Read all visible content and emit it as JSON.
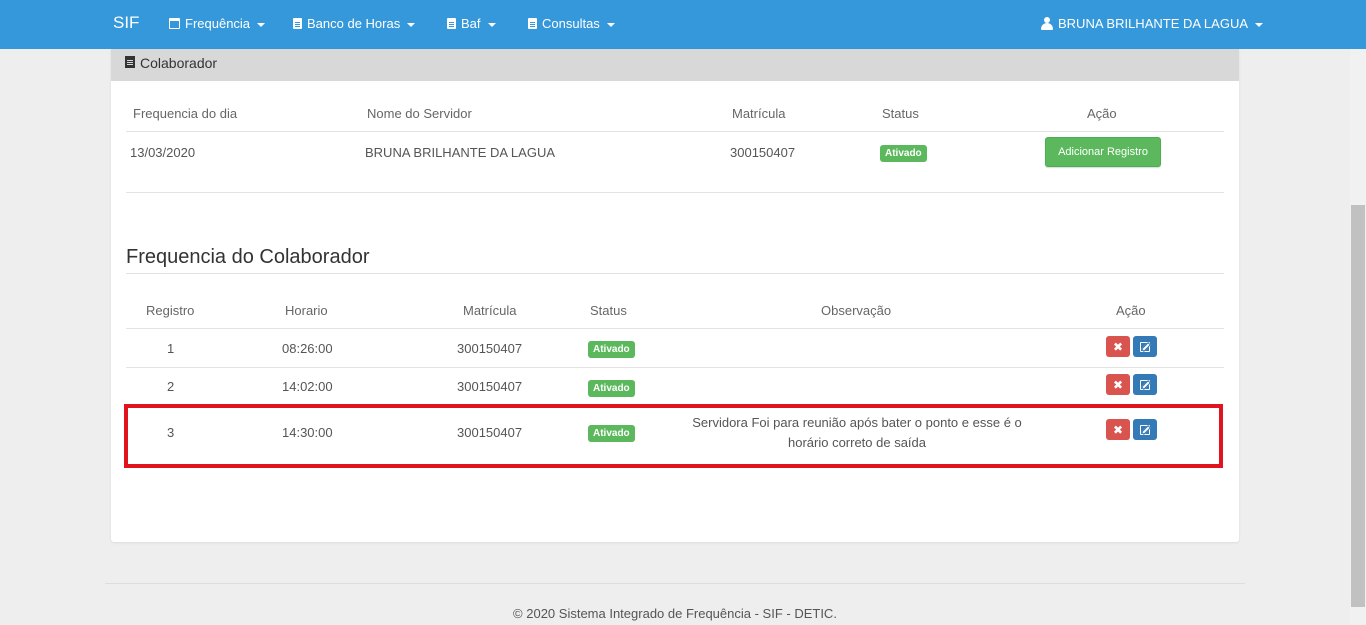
{
  "navbar": {
    "brand": "SIF",
    "menu": [
      {
        "label": "Frequência",
        "icon": "calendar-icon"
      },
      {
        "label": "Banco de Horas",
        "icon": "document-icon"
      },
      {
        "label": "Baf",
        "icon": "document-icon"
      },
      {
        "label": "Consultas",
        "icon": "document-search-icon"
      }
    ],
    "user": "BRUNA BRILHANTE DA LAGUA"
  },
  "panel": {
    "heading": "Colaborador",
    "table": {
      "headers": [
        "Frequencia do dia",
        "Nome do Servidor",
        "Matrícula",
        "Status",
        "Ação"
      ],
      "row": {
        "date": "13/03/2020",
        "name": "BRUNA BRILHANTE DA LAGUA",
        "matricula": "300150407",
        "status": "Ativado",
        "action": "Adicionar Registro"
      }
    }
  },
  "frequency": {
    "title": "Frequencia do Colaborador",
    "headers": [
      "Registro",
      "Horario",
      "Matrícula",
      "Status",
      "Observação",
      "Ação"
    ],
    "rows": [
      {
        "registro": "1",
        "horario": "08:26:00",
        "matricula": "300150407",
        "status": "Ativado",
        "obs1": "",
        "obs2": ""
      },
      {
        "registro": "2",
        "horario": "14:02:00",
        "matricula": "300150407",
        "status": "Ativado",
        "obs1": "",
        "obs2": ""
      },
      {
        "registro": "3",
        "horario": "14:30:00",
        "matricula": "300150407",
        "status": "Ativado",
        "obs1": "Servidora Foi para reunião após bater o ponto e esse é o",
        "obs2": "horário correto de saída"
      }
    ]
  },
  "footer": "© 2020 Sistema Integrado de Frequência - SIF - DETIC.",
  "colors": {
    "navbar": "#3498db",
    "success": "#5cb85c",
    "danger": "#d9534f",
    "primary": "#337ab7",
    "highlight": "#e0141e"
  }
}
